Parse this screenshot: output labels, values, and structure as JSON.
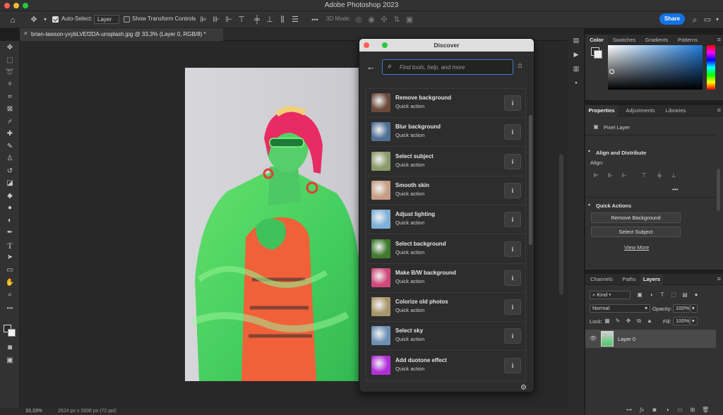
{
  "app": {
    "title": "Adobe Photoshop 2023",
    "share_label": "Share",
    "traffic_colors": [
      "#ff5f57",
      "#febc2e",
      "#28c840"
    ]
  },
  "options_bar": {
    "auto_select_label": "Auto-Select:",
    "auto_select_value": "Layer",
    "show_transform_label": "Show Transform Controls",
    "mode_3d_label": "3D Mode:"
  },
  "document_tab": {
    "label": "brian-lawson-yxybLVEf2DA-unsplash.jpg @ 33,3% (Layer 0, RGB/8) *"
  },
  "status_bar": {
    "zoom": "33,33%",
    "dimensions": "2624 px x 3936 px (72 ppi)"
  },
  "discover": {
    "title": "Discover",
    "search_placeholder": "Find tools, help, and more",
    "items": [
      {
        "name": "Remove background",
        "sub": "Quick action",
        "thumb": "#6b4a3a"
      },
      {
        "name": "Blur background",
        "sub": "Quick action",
        "thumb": "#4f6f95"
      },
      {
        "name": "Select subject",
        "sub": "Quick action",
        "thumb": "#8a9a6a"
      },
      {
        "name": "Smooth skin",
        "sub": "Quick action",
        "thumb": "#c79d84"
      },
      {
        "name": "Adjust lighting",
        "sub": "Quick action",
        "thumb": "#7fb0d8"
      },
      {
        "name": "Select background",
        "sub": "Quick action",
        "thumb": "#3f7a2d"
      },
      {
        "name": "Make B/W background",
        "sub": "Quick action",
        "thumb": "#d0487a"
      },
      {
        "name": "Colorize old photos",
        "sub": "Quick action",
        "thumb": "#a8956a"
      },
      {
        "name": "Select sky",
        "sub": "Quick action",
        "thumb": "#6c8fb4"
      },
      {
        "name": "Add duotone effect",
        "sub": "Quick action",
        "thumb": "#b22fd8"
      }
    ]
  },
  "color_panel": {
    "tabs": [
      "Color",
      "Swatches",
      "Gradients",
      "Patterns"
    ]
  },
  "properties_panel": {
    "tabs": [
      "Properties",
      "Adjustments",
      "Libraries"
    ],
    "layer_kind": "Pixel Layer",
    "align_title": "Align and Distribute",
    "align_label": "Align:",
    "quick_actions_title": "Quick Actions",
    "remove_bg_label": "Remove Background",
    "select_subject_label": "Select Subject",
    "view_more_label": "View More"
  },
  "layers_panel": {
    "tabs": [
      "Channels",
      "Paths",
      "Layers"
    ],
    "kind_label": "Kind",
    "blend_mode": "Normal",
    "opacity_label": "Opacity:",
    "opacity_value": "100%",
    "lock_label": "Lock:",
    "fill_label": "Fill:",
    "fill_value": "100%",
    "layer_name": "Layer 0"
  }
}
